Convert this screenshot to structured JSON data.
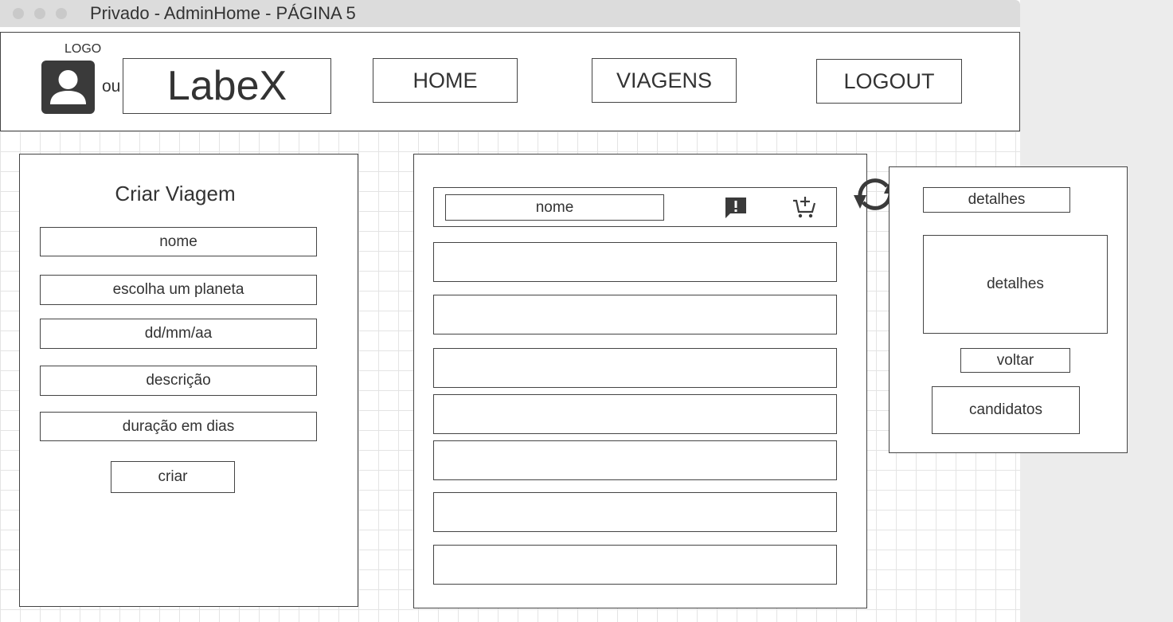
{
  "window": {
    "title": "Privado - AdminHome - PÁGINA 5"
  },
  "header": {
    "logo_label": "LOGO",
    "or_label": "ou",
    "brand": "LabeX",
    "nav": {
      "home": "HOME",
      "viagens": "VIAGENS",
      "logout": "LOGOUT"
    }
  },
  "create_form": {
    "title": "Criar Viagem",
    "fields": {
      "nome": "nome",
      "planeta": "escolha um planeta",
      "data": "dd/mm/aa",
      "descricao": "descrição",
      "duracao": "duração em dias"
    },
    "submit": "criar"
  },
  "trip_list": {
    "first_row_name": "nome",
    "row_count": 7,
    "icons": [
      "alert-icon",
      "add-to-cart-icon"
    ]
  },
  "details_panel": {
    "title_field": "detalhes",
    "body": "detalhes",
    "back": "voltar",
    "candidates": "candidatos",
    "flow_icon": "refresh-icon"
  },
  "colors": {
    "stroke": "#444444",
    "icon": "#3a3a3a",
    "window_bg": "#ffffff",
    "titlebar": "#dcdcdc",
    "grid": "#e4e4e4"
  }
}
